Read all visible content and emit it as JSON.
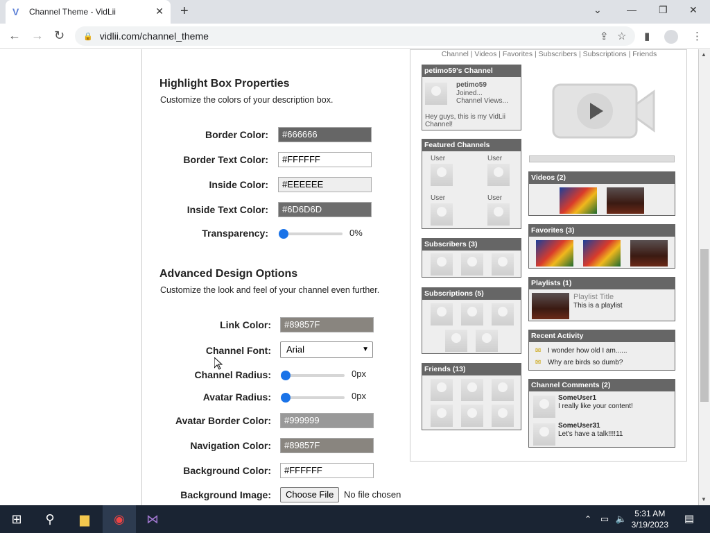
{
  "browser": {
    "tab_title": "Channel Theme - VidLii",
    "url": "vidlii.com/channel_theme"
  },
  "highlight": {
    "title": "Highlight Box Properties",
    "desc": "Customize the colors of your description box.",
    "fields": [
      {
        "label": "Border Color:",
        "value": "#666666",
        "bg": "#666666",
        "fg": "#FFFFFF"
      },
      {
        "label": "Border Text Color:",
        "value": "#FFFFFF",
        "bg": "#FFFFFF",
        "fg": "#000000"
      },
      {
        "label": "Inside Color:",
        "value": "#EEEEEE",
        "bg": "#EEEEEE",
        "fg": "#000000"
      },
      {
        "label": "Inside Text Color:",
        "value": "#6D6D6D",
        "bg": "#6D6D6D",
        "fg": "#FFFFFF"
      }
    ],
    "transparency_label": "Transparency:",
    "transparency_value": "0%"
  },
  "advanced": {
    "title": "Advanced Design Options",
    "desc": "Customize the look and feel of your channel even further.",
    "link_color_label": "Link Color:",
    "link_color": "#89857F",
    "font_label": "Channel Font:",
    "font_value": "Arial",
    "channel_radius_label": "Channel Radius:",
    "channel_radius_value": "0px",
    "avatar_radius_label": "Avatar Radius:",
    "avatar_radius_value": "0px",
    "avatar_border_label": "Avatar Border Color:",
    "avatar_border_value": "#999999",
    "nav_color_label": "Navigation Color:",
    "nav_color_value": "#89857F",
    "bg_color_label": "Background Color:",
    "bg_color_value": "#FFFFFF",
    "bg_image_label": "Background Image:",
    "choose_file": "Choose File",
    "no_file": "No file chosen"
  },
  "preview": {
    "nav": "Channel  |  Videos  |  Favorites  |  Subscribers  |  Subscriptions  |  Friends",
    "channel_title": "petimo59's Channel",
    "username": "petimo59",
    "joined": "Joined...",
    "views": "Channel Views...",
    "about": "Hey guys, this is my VidLii Channel!",
    "featured_title": "Featured Channels",
    "user": "User",
    "subscribers_title": "Subscribers (3)",
    "subscriptions_title": "Subscriptions (5)",
    "friends_title": "Friends (13)",
    "videos_title": "Videos (2)",
    "favorites_title": "Favorites (3)",
    "playlists_title": "Playlists (1)",
    "playlist_name": "Playlist Title",
    "playlist_desc": "This is a playlist",
    "activity_title": "Recent Activity",
    "activity_1": "I wonder how old I am......",
    "activity_2": "Why are birds so dumb?",
    "comments_title": "Channel Comments (2)",
    "comment_1_user": "SomeUser1",
    "comment_1_text": "I really like your content!",
    "comment_2_user": "SomeUser31",
    "comment_2_text": "Let's have a talk!!!!11"
  },
  "taskbar": {
    "time": "5:31 AM",
    "date": "3/19/2023"
  }
}
